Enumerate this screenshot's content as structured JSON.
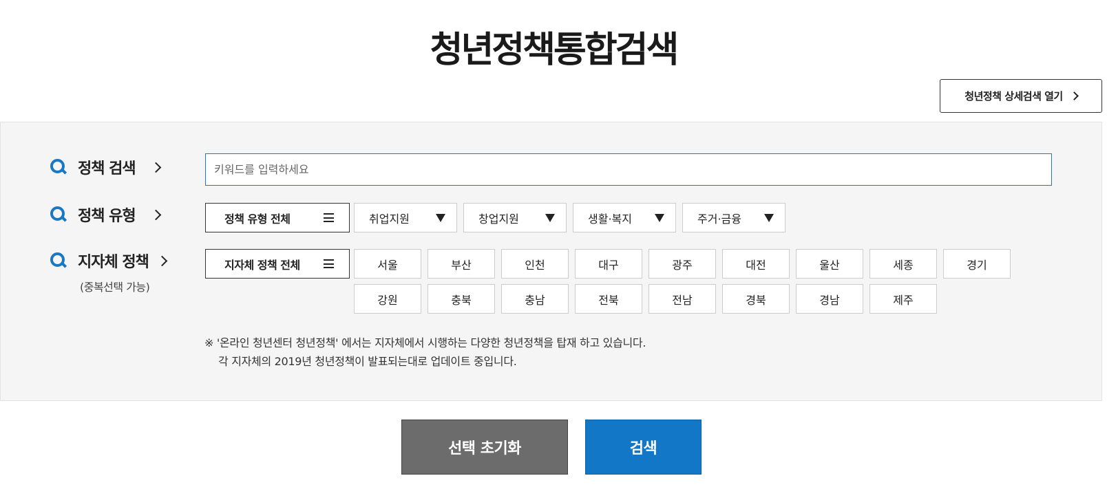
{
  "title": "청년정책통합검색",
  "detail_search_button": "청년정책 상세검색 열기",
  "keyword": {
    "label": "정책 검색",
    "placeholder": "키워드를 입력하세요",
    "value": ""
  },
  "policy_type": {
    "label": "정책 유형",
    "all": "정책 유형 전체",
    "options": [
      "취업지원",
      "창업지원",
      "생활·복지",
      "주거·금융"
    ]
  },
  "local": {
    "label": "지자체 정책",
    "sublabel": "(중복선택 가능)",
    "all": "지자체 정책 전체",
    "regions": [
      "서울",
      "부산",
      "인천",
      "대구",
      "광주",
      "대전",
      "울산",
      "세종",
      "경기",
      "강원",
      "충북",
      "충남",
      "전북",
      "전남",
      "경북",
      "경남",
      "제주"
    ]
  },
  "notice": {
    "line1": "※ '온라인 청년센터 청년정책' 에서는 지자체에서 시행하는 다양한 청년정책을 탑재 하고 있습니다.",
    "line2": "각 지자체의 2019년 청년정책이 발표되는대로 업데이트 중입니다."
  },
  "buttons": {
    "reset": "선택 초기화",
    "search": "검색"
  },
  "colors": {
    "accent": "#1177c6",
    "reset": "#6c6c6c",
    "panel": "#f5f5f5"
  }
}
